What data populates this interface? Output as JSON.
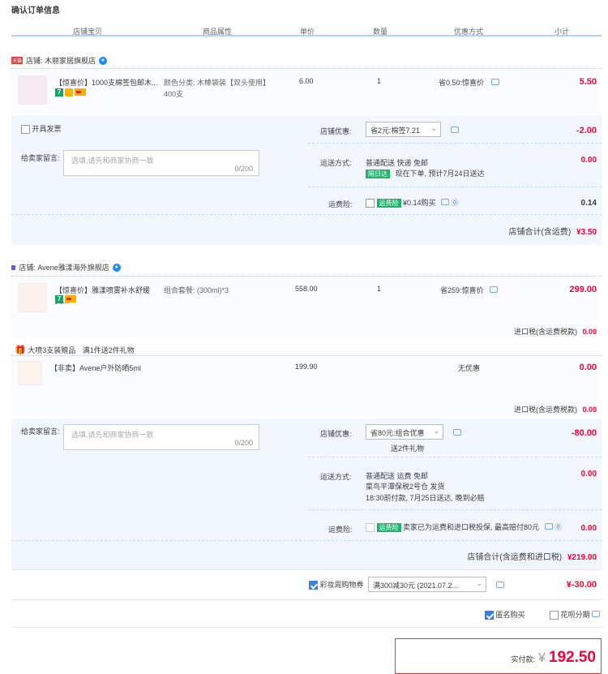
{
  "page_title": "确认订单信息",
  "columns": [
    "店铺宝贝",
    "商品属性",
    "单价",
    "数量",
    "优惠方式",
    "小计"
  ],
  "shop1": {
    "badge": "天猫",
    "name": "店铺: 木丽家居旗舰店",
    "product": {
      "title": "【惊喜价】1000支棉签包邮木...",
      "attr": "颜色分类: 木棒袋装【双头使用】400支",
      "price": "6.00",
      "qty": "1",
      "discount": "省0.50:惊喜价",
      "subtotal": "5.50"
    },
    "invoice_label": "开具发票",
    "shop_discount_label": "店铺优惠:",
    "shop_discount_value": "省2元:棉签7.21",
    "shop_discount_amount": "-2.00",
    "note_label": "给卖家留言:",
    "note_placeholder": "选填,请先和商家协商一致",
    "note_count": "0/200",
    "shipping_label": "运送方式:",
    "shipping_value": "普通配送 快递 免邮",
    "shipping_tag": "隔日达",
    "shipping_eta": "现在下单, 预计7月24日送达",
    "shipping_amount": "0.00",
    "insurance_label": "运费险:",
    "insurance_tag": "运费险",
    "insurance_text": "¥0.14购买",
    "insurance_amount": "0.14",
    "total_label": "店铺合计(含运费)",
    "total_value": "¥3.50"
  },
  "shop2": {
    "name": "店铺: Avene雅漾海外旗舰店",
    "product": {
      "title": "【惊喜价】雅漾喷雾补水舒缓爽...",
      "attr": "组合套餐: (300ml)*3",
      "price": "558.00",
      "qty": "1",
      "discount": "省259:惊喜价",
      "subtotal": "299.00"
    },
    "tax_label": "进口税(含运费税款)",
    "tax_value": "0.00",
    "gift_label": "大喷3支装赠品",
    "gift_rule": "满1件送2件礼物",
    "gift": {
      "title": "【非卖】Avene户外防晒5ml",
      "price": "199.90",
      "discount": "无优惠",
      "subtotal": "0.00"
    },
    "gift_tax_label": "进口税(含运费税款)",
    "gift_tax_value": "0.00",
    "note_label": "给卖家留言:",
    "note_placeholder": "选填,请先和商家协商一致",
    "note_count": "0/200",
    "shop_discount_label": "店铺优惠:",
    "shop_discount_value": "省80元:组合优惠",
    "shop_discount_sub": "送2件礼物",
    "shop_discount_amount": "-80.00",
    "shipping_label": "运送方式:",
    "shipping_value": "普通配送 运费 免邮",
    "shipping_warehouse": "菜鸟平潭保税2号仓  发货",
    "shipping_eta": "18:30前付款, 7月25日送达, 晚到必赔",
    "shipping_amount": "0.00",
    "insurance_label": "运费险:",
    "insurance_tag": "运费险",
    "insurance_text": "卖家已为运费和进口税投保, 最高赔付80元",
    "insurance_amount": "0.00",
    "total_label": "店铺合计(含运费和进口税)",
    "total_value": "¥219.00"
  },
  "coupon": {
    "label": "彩妆周购物券",
    "value": "满300减30元 (2021.07.2...",
    "amount": "¥-30.00"
  },
  "anonymous_label": "匿名购买",
  "huabei_label": "花呗分期",
  "pay": {
    "label": "实付款:",
    "currency": "¥",
    "amount": "192.50"
  }
}
